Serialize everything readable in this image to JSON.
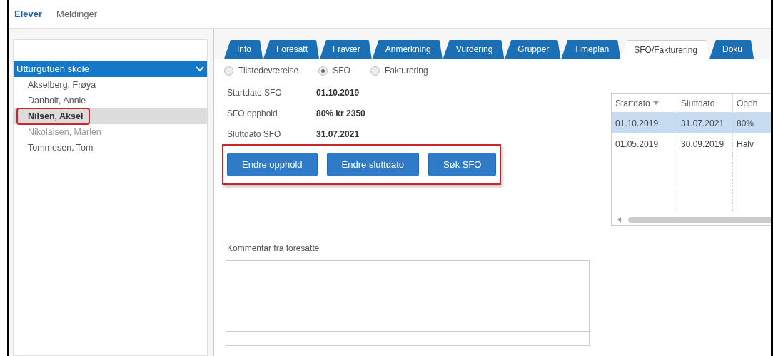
{
  "nav": [
    {
      "label": "Elever",
      "selected": true
    },
    {
      "label": "Meldinger",
      "selected": false
    }
  ],
  "sidebar": {
    "group": {
      "label": "Utturgutuen skole",
      "expanded": true
    },
    "items": [
      {
        "label": "Akselberg, Frøya",
        "selected": false,
        "dimmed": false,
        "marked": false
      },
      {
        "label": "Danbolt, Annie",
        "selected": false,
        "dimmed": false,
        "marked": false
      },
      {
        "label": "Nilsen, Aksel",
        "selected": true,
        "dimmed": false,
        "marked": true
      },
      {
        "label": "Nikolaisen, Marlen",
        "selected": false,
        "dimmed": true,
        "marked": false
      },
      {
        "label": "Tommesen, Tom",
        "selected": false,
        "dimmed": false,
        "marked": false
      }
    ]
  },
  "tabs": [
    {
      "label": "Info",
      "selected": false
    },
    {
      "label": "Foresatt",
      "selected": false
    },
    {
      "label": "Fravær",
      "selected": false
    },
    {
      "label": "Anmerkning",
      "selected": false
    },
    {
      "label": "Vurdering",
      "selected": false
    },
    {
      "label": "Grupper",
      "selected": false
    },
    {
      "label": "Timeplan",
      "selected": false
    },
    {
      "label": "SFO/Fakturering",
      "selected": true
    },
    {
      "label": "Doku",
      "selected": false
    }
  ],
  "radios": [
    {
      "label": "Tilstedeværelse",
      "selected": false
    },
    {
      "label": "SFO",
      "selected": true
    },
    {
      "label": "Fakturering",
      "selected": false
    }
  ],
  "fields": [
    {
      "label": "Startdato SFO",
      "value": "01.10.2019"
    },
    {
      "label": "SFO opphold",
      "value": "80% kr 2350"
    },
    {
      "label": "Sluttdato SFO",
      "value": "31.07.2021"
    }
  ],
  "buttons": {
    "marked": true,
    "items": [
      "Endre opphold",
      "Endre sluttdato",
      "Søk SFO"
    ]
  },
  "table": {
    "columns": [
      {
        "label": "Startdato",
        "sorted": true
      },
      {
        "label": "Sluttdato",
        "sorted": false
      },
      {
        "label": "Opph",
        "sorted": false
      }
    ],
    "rows": [
      {
        "cells": [
          "01.10.2019",
          "31.07.2021",
          "80%"
        ],
        "selected": true
      },
      {
        "cells": [
          "01.05.2019",
          "30.09.2019",
          "Halv"
        ],
        "selected": false
      }
    ]
  },
  "comment": {
    "label": "Kommentar fra foresatte"
  }
}
